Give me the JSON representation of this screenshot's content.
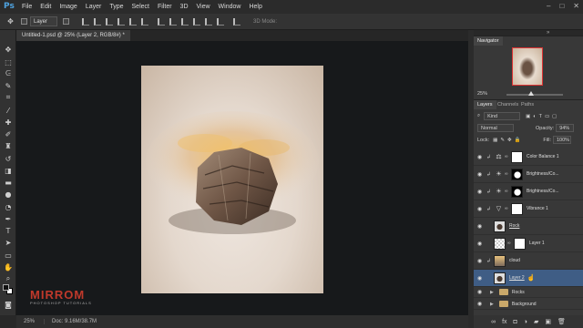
{
  "app": {
    "logo": "Ps"
  },
  "menu": [
    "File",
    "Edit",
    "Image",
    "Layer",
    "Type",
    "Select",
    "Filter",
    "3D",
    "View",
    "Window",
    "Help"
  ],
  "window_controls": [
    "–",
    "□",
    "✕"
  ],
  "options_bar": {
    "auto_select_target": "Layer",
    "mode_3d_label": "3D Mode:"
  },
  "document_tab": "Untitled-1.psd @ 25% (Layer 2, RGB/8#) *",
  "status": {
    "zoom": "25%",
    "doc": "Doc: 9.16M/38.7M"
  },
  "watermark": {
    "main": "MIRROM",
    "sub": "PHOTOSHOP TUTORIALS"
  },
  "navigator": {
    "tab": "Navigator",
    "zoom": "25%"
  },
  "layers_panel": {
    "tabs": [
      "Layers",
      "Channels",
      "Paths"
    ],
    "filter_label": "Kind",
    "blend_mode": "Normal",
    "opacity_label": "Opacity:",
    "opacity": "94%",
    "lock_label": "Lock:",
    "fill_label": "Fill:",
    "fill": "100%",
    "layers": [
      {
        "name": "Color Balance 1"
      },
      {
        "name": "Brightness/Co..."
      },
      {
        "name": "Brightness/Co..."
      },
      {
        "name": "Vibrance 1"
      },
      {
        "name": "Rock"
      },
      {
        "name": "Layer 1"
      },
      {
        "name": "cloud"
      },
      {
        "name": "Layer 2"
      },
      {
        "name": "Rocks"
      },
      {
        "name": "Background"
      }
    ]
  },
  "colors": {
    "accent": "#3f5d85",
    "watermark": "#c0392b",
    "canvas_bg": "#17191b"
  }
}
